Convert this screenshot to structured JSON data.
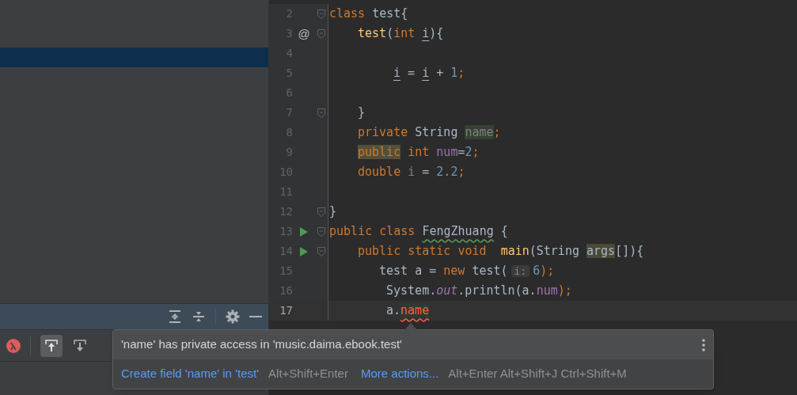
{
  "editor": {
    "lines": [
      {
        "number": "2",
        "runnable": false,
        "fold": true,
        "current": false,
        "kind": "none",
        "tokens": [
          {
            "text": "class ",
            "kind": "kw"
          },
          {
            "text": "test{",
            "kind": "plain"
          }
        ]
      },
      {
        "number": "3",
        "marker": "@",
        "runnable": false,
        "fold": true,
        "current": false,
        "kind": "member",
        "tokens": [
          {
            "text": "test",
            "kind": "method"
          },
          {
            "text": "(",
            "kind": "plain"
          },
          {
            "text": "int ",
            "kind": "kw"
          },
          {
            "text": "i",
            "kind": "param"
          },
          {
            "text": "){",
            "kind": "plain"
          }
        ]
      },
      {
        "number": "4",
        "runnable": false,
        "fold": false,
        "current": false,
        "kind": "none"
      },
      {
        "number": "5",
        "runnable": false,
        "fold": false,
        "current": false,
        "kind": "block",
        "tokens": [
          {
            "text": "i",
            "kind": "param"
          },
          {
            "text": " = ",
            "kind": "plain"
          },
          {
            "text": "i",
            "kind": "param"
          },
          {
            "text": " + ",
            "kind": "plain"
          },
          {
            "text": "1",
            "kind": "num"
          },
          {
            "text": ";",
            "kind": "kw"
          }
        ]
      },
      {
        "number": "6",
        "runnable": false,
        "fold": false,
        "current": false,
        "kind": "none"
      },
      {
        "number": "7",
        "runnable": false,
        "fold": true,
        "current": false,
        "kind": "member",
        "tokens": [
          {
            "text": "}",
            "kind": "plain"
          }
        ]
      },
      {
        "number": "8",
        "runnable": false,
        "fold": false,
        "current": false,
        "kind": "member",
        "tokens": [
          {
            "text": "private ",
            "kind": "kw"
          },
          {
            "text": "String ",
            "kind": "plain"
          },
          {
            "text": "name",
            "kind": "unused_mark"
          },
          {
            "text": ";",
            "kind": "kw"
          }
        ]
      },
      {
        "number": "9",
        "runnable": false,
        "fold": false,
        "current": false,
        "kind": "member",
        "tokens": [
          {
            "text": "public",
            "kind": "kw_mark"
          },
          {
            "text": " int ",
            "kind": "kw"
          },
          {
            "text": "num",
            "kind": "field"
          },
          {
            "text": "=",
            "kind": "plain"
          },
          {
            "text": "2",
            "kind": "num"
          },
          {
            "text": ";",
            "kind": "kw"
          }
        ]
      },
      {
        "number": "10",
        "runnable": false,
        "fold": false,
        "current": false,
        "kind": "member",
        "tokens": [
          {
            "text": "double ",
            "kind": "kw"
          },
          {
            "text": "i",
            "kind": "unused"
          },
          {
            "text": " = ",
            "kind": "plain"
          },
          {
            "text": "2.2",
            "kind": "num"
          },
          {
            "text": ";",
            "kind": "kw"
          }
        ]
      },
      {
        "number": "11",
        "runnable": false,
        "fold": false,
        "current": false,
        "kind": "none"
      },
      {
        "number": "12",
        "runnable": false,
        "fold": true,
        "current": false,
        "kind": "none",
        "tokens": [
          {
            "text": "}",
            "kind": "plain"
          }
        ]
      },
      {
        "number": "13",
        "runnable": true,
        "fold": true,
        "current": false,
        "kind": "none",
        "tokens": [
          {
            "text": "public ",
            "kind": "kw"
          },
          {
            "text": "class ",
            "kind": "kw"
          },
          {
            "text": "FengZhuang",
            "kind": "typo"
          },
          {
            "text": " {",
            "kind": "plain"
          }
        ]
      },
      {
        "number": "14",
        "runnable": true,
        "fold": true,
        "current": false,
        "kind": "member",
        "tokens": [
          {
            "text": "public ",
            "kind": "kw"
          },
          {
            "text": "static ",
            "kind": "kw"
          },
          {
            "text": "void  ",
            "kind": "kw"
          },
          {
            "text": "main",
            "kind": "method"
          },
          {
            "text": "(String ",
            "kind": "plain"
          },
          {
            "text": "args",
            "kind": "plain_mark"
          },
          {
            "text": "[]){",
            "kind": "plain"
          }
        ]
      },
      {
        "number": "15",
        "runnable": false,
        "fold": false,
        "current": false,
        "kind": "statement",
        "tokens": [
          {
            "text": "test a = ",
            "kind": "plain"
          },
          {
            "text": "new ",
            "kind": "kw"
          },
          {
            "text": "test(",
            "kind": "plain"
          },
          {
            "text": "i:",
            "kind": "hint"
          },
          {
            "text": "6",
            "kind": "num"
          },
          {
            "text": ");",
            "kind": "kw"
          }
        ]
      },
      {
        "number": "16",
        "runnable": false,
        "fold": false,
        "current": false,
        "kind": "statement_wide",
        "tokens": [
          {
            "text": "System.",
            "kind": "plain"
          },
          {
            "text": "out",
            "kind": "static"
          },
          {
            "text": ".println(a.",
            "kind": "plain"
          },
          {
            "text": "num",
            "kind": "field"
          },
          {
            "text": ");",
            "kind": "kw"
          }
        ]
      },
      {
        "number": "17",
        "runnable": false,
        "fold": false,
        "current": true,
        "kind": "statement_wide",
        "tokens": [
          {
            "text": "a.",
            "kind": "plain"
          },
          {
            "text": "name",
            "kind": "error"
          }
        ]
      }
    ]
  },
  "popup": {
    "message": "'name' has private access in 'music.daima.ebook.test'",
    "actions": [
      {
        "label": "Create field 'name' in 'test'",
        "shortcut": "Alt+Shift+Enter"
      },
      {
        "label": "More actions...",
        "shortcut": "Alt+Enter Alt+Shift+J Ctrl+Shift+M"
      }
    ]
  }
}
